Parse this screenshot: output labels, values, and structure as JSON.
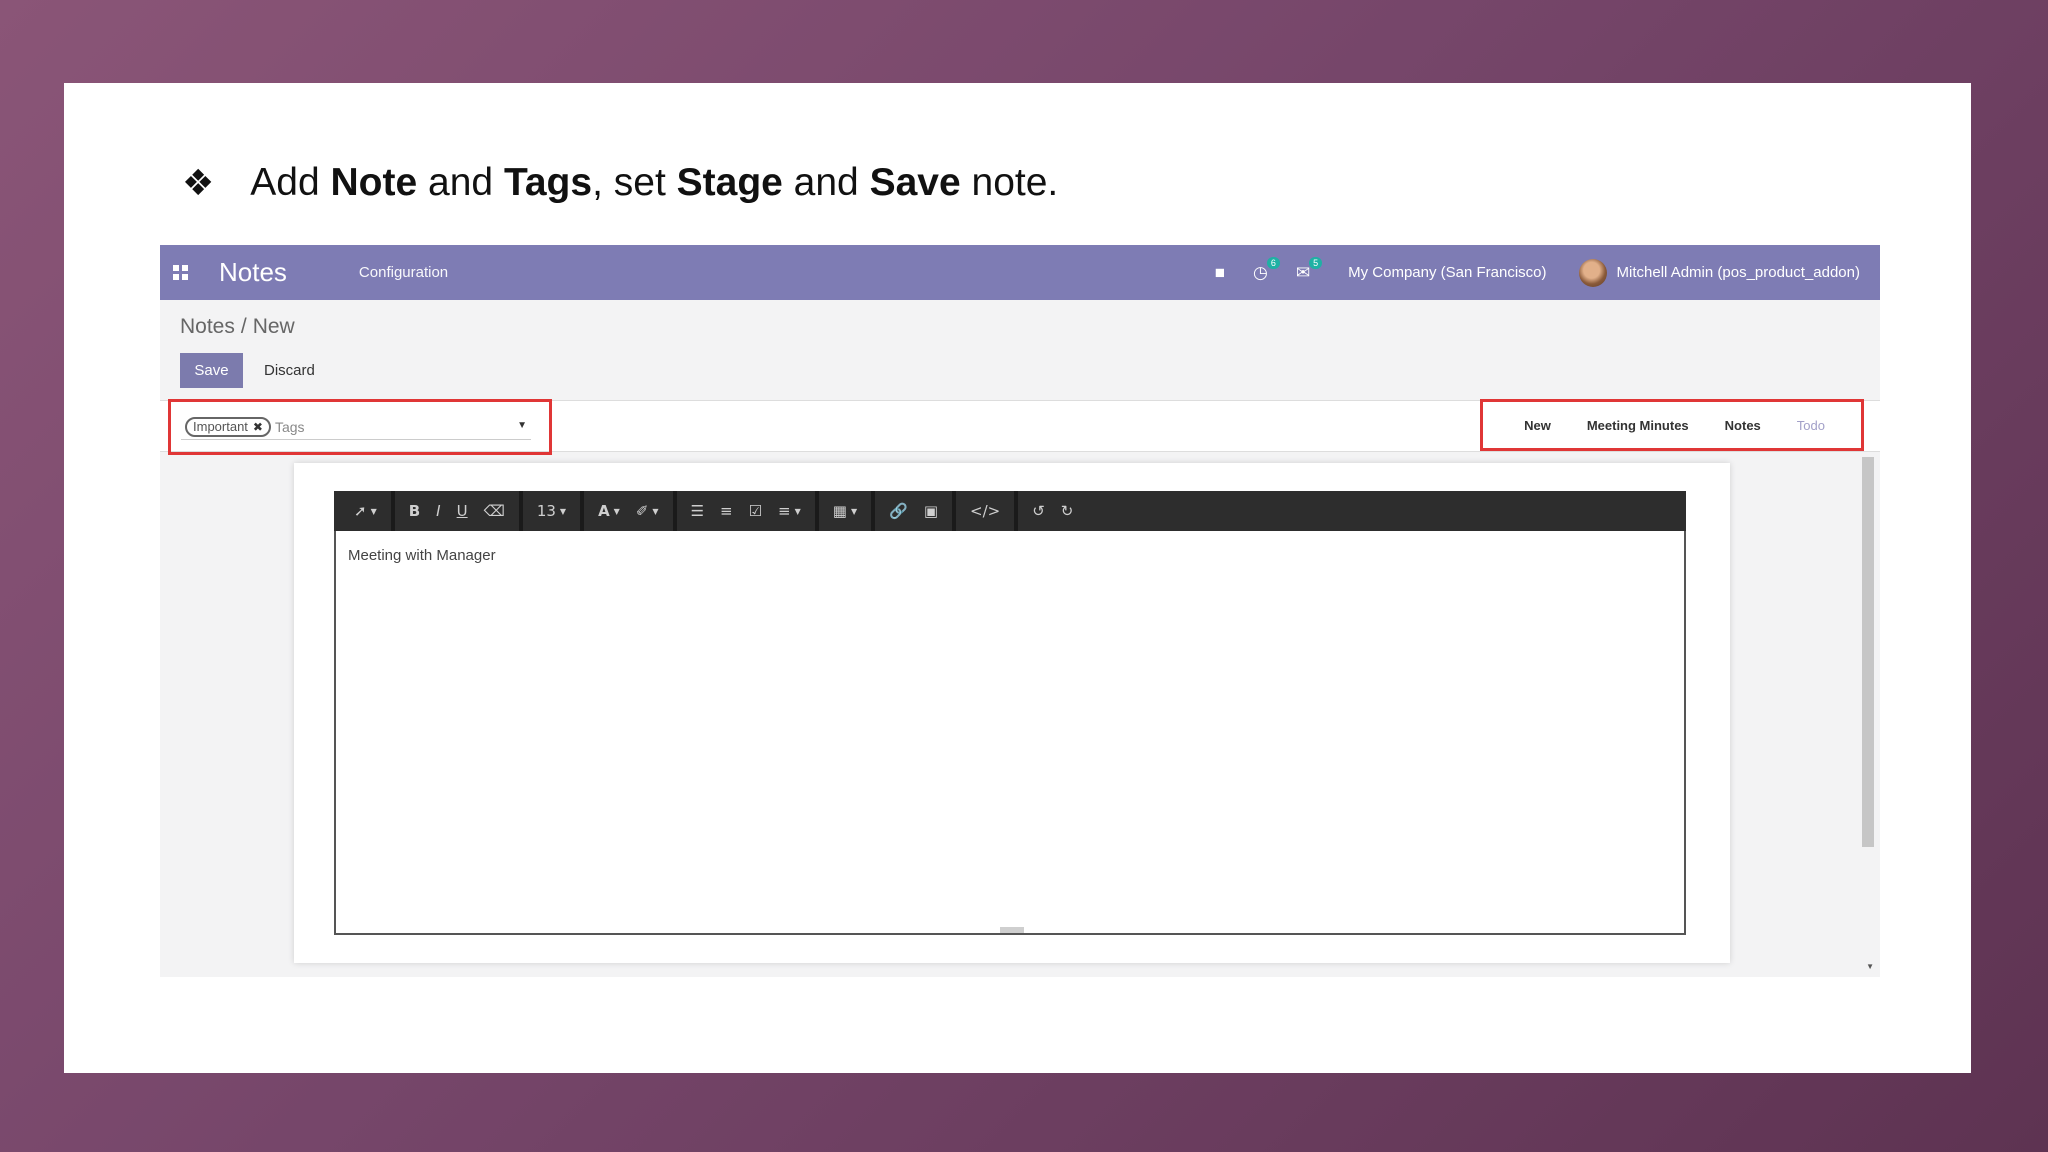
{
  "heading": {
    "bullet": "❖",
    "p1": "Add ",
    "b1": "Note",
    "p2": " and ",
    "b2": "Tags",
    "p3": ", set ",
    "b3": "Stage",
    "p4": " and ",
    "b4": "Save",
    "p5": " note."
  },
  "navbar": {
    "title": "Notes",
    "menu_configuration": "Configuration",
    "activity_badge": "6",
    "messages_badge": "5",
    "company": "My Company (San Francisco)",
    "user": "Mitchell Admin (pos_product_addon)"
  },
  "breadcrumb": {
    "parent": "Notes",
    "separator": "/",
    "current": "New"
  },
  "buttons": {
    "save": "Save",
    "discard": "Discard"
  },
  "tags": {
    "chip": "Important",
    "placeholder": "Tags"
  },
  "stages": [
    {
      "label": "New"
    },
    {
      "label": "Meeting Minutes"
    },
    {
      "label": "Notes"
    },
    {
      "label": "Todo"
    }
  ],
  "editor": {
    "font_size": "13",
    "content": "Meeting with Manager"
  },
  "colors": {
    "navbar": "#7e7cb4",
    "save_button": "#7c7bad",
    "highlight_box": "#e03636",
    "active_stage": "#a2a0c8"
  }
}
